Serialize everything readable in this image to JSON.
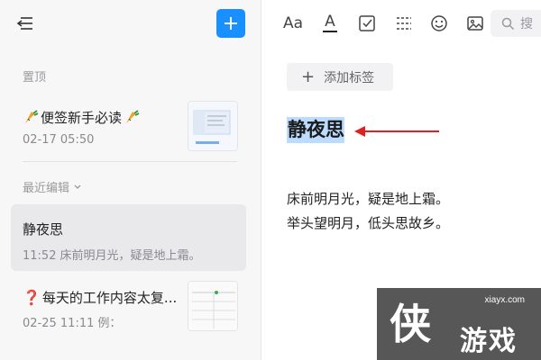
{
  "sidebar": {
    "pinned_label": "置顶",
    "recent_label": "最近编辑",
    "notes": [
      {
        "title": "便签新手必读",
        "date": "02-17 05:50",
        "preview": ""
      },
      {
        "title": "静夜思",
        "date": "11:52",
        "preview": "床前明月光，疑是地上霜。"
      },
      {
        "title": "每天的工作内容太复...",
        "date": "02-25 11:11",
        "preview": "例："
      }
    ]
  },
  "toolbar": {
    "font_icon_label": "Aa",
    "color_icon_label": "A",
    "search_placeholder": "搜"
  },
  "editor": {
    "add_tag_label": "添加标签",
    "title": "静夜思",
    "lines": [
      "床前明月光，疑是地上霜。",
      "举头望明月，低头思故乡。"
    ]
  },
  "watermark": {
    "site": "xiayx.com",
    "logo_char": "侠",
    "name": "游戏"
  },
  "colors": {
    "accent": "#1890ff",
    "selection": "#bcdcff",
    "arrow": "#e02020"
  },
  "icons": [
    "collapse-sidebar-icon",
    "plus-icon",
    "font-size-icon",
    "text-color-icon",
    "checkbox-icon",
    "divider-icon",
    "emoji-icon",
    "image-icon",
    "search-icon",
    "carrot-icon",
    "question-mark-icon",
    "chevron-down-icon"
  ]
}
